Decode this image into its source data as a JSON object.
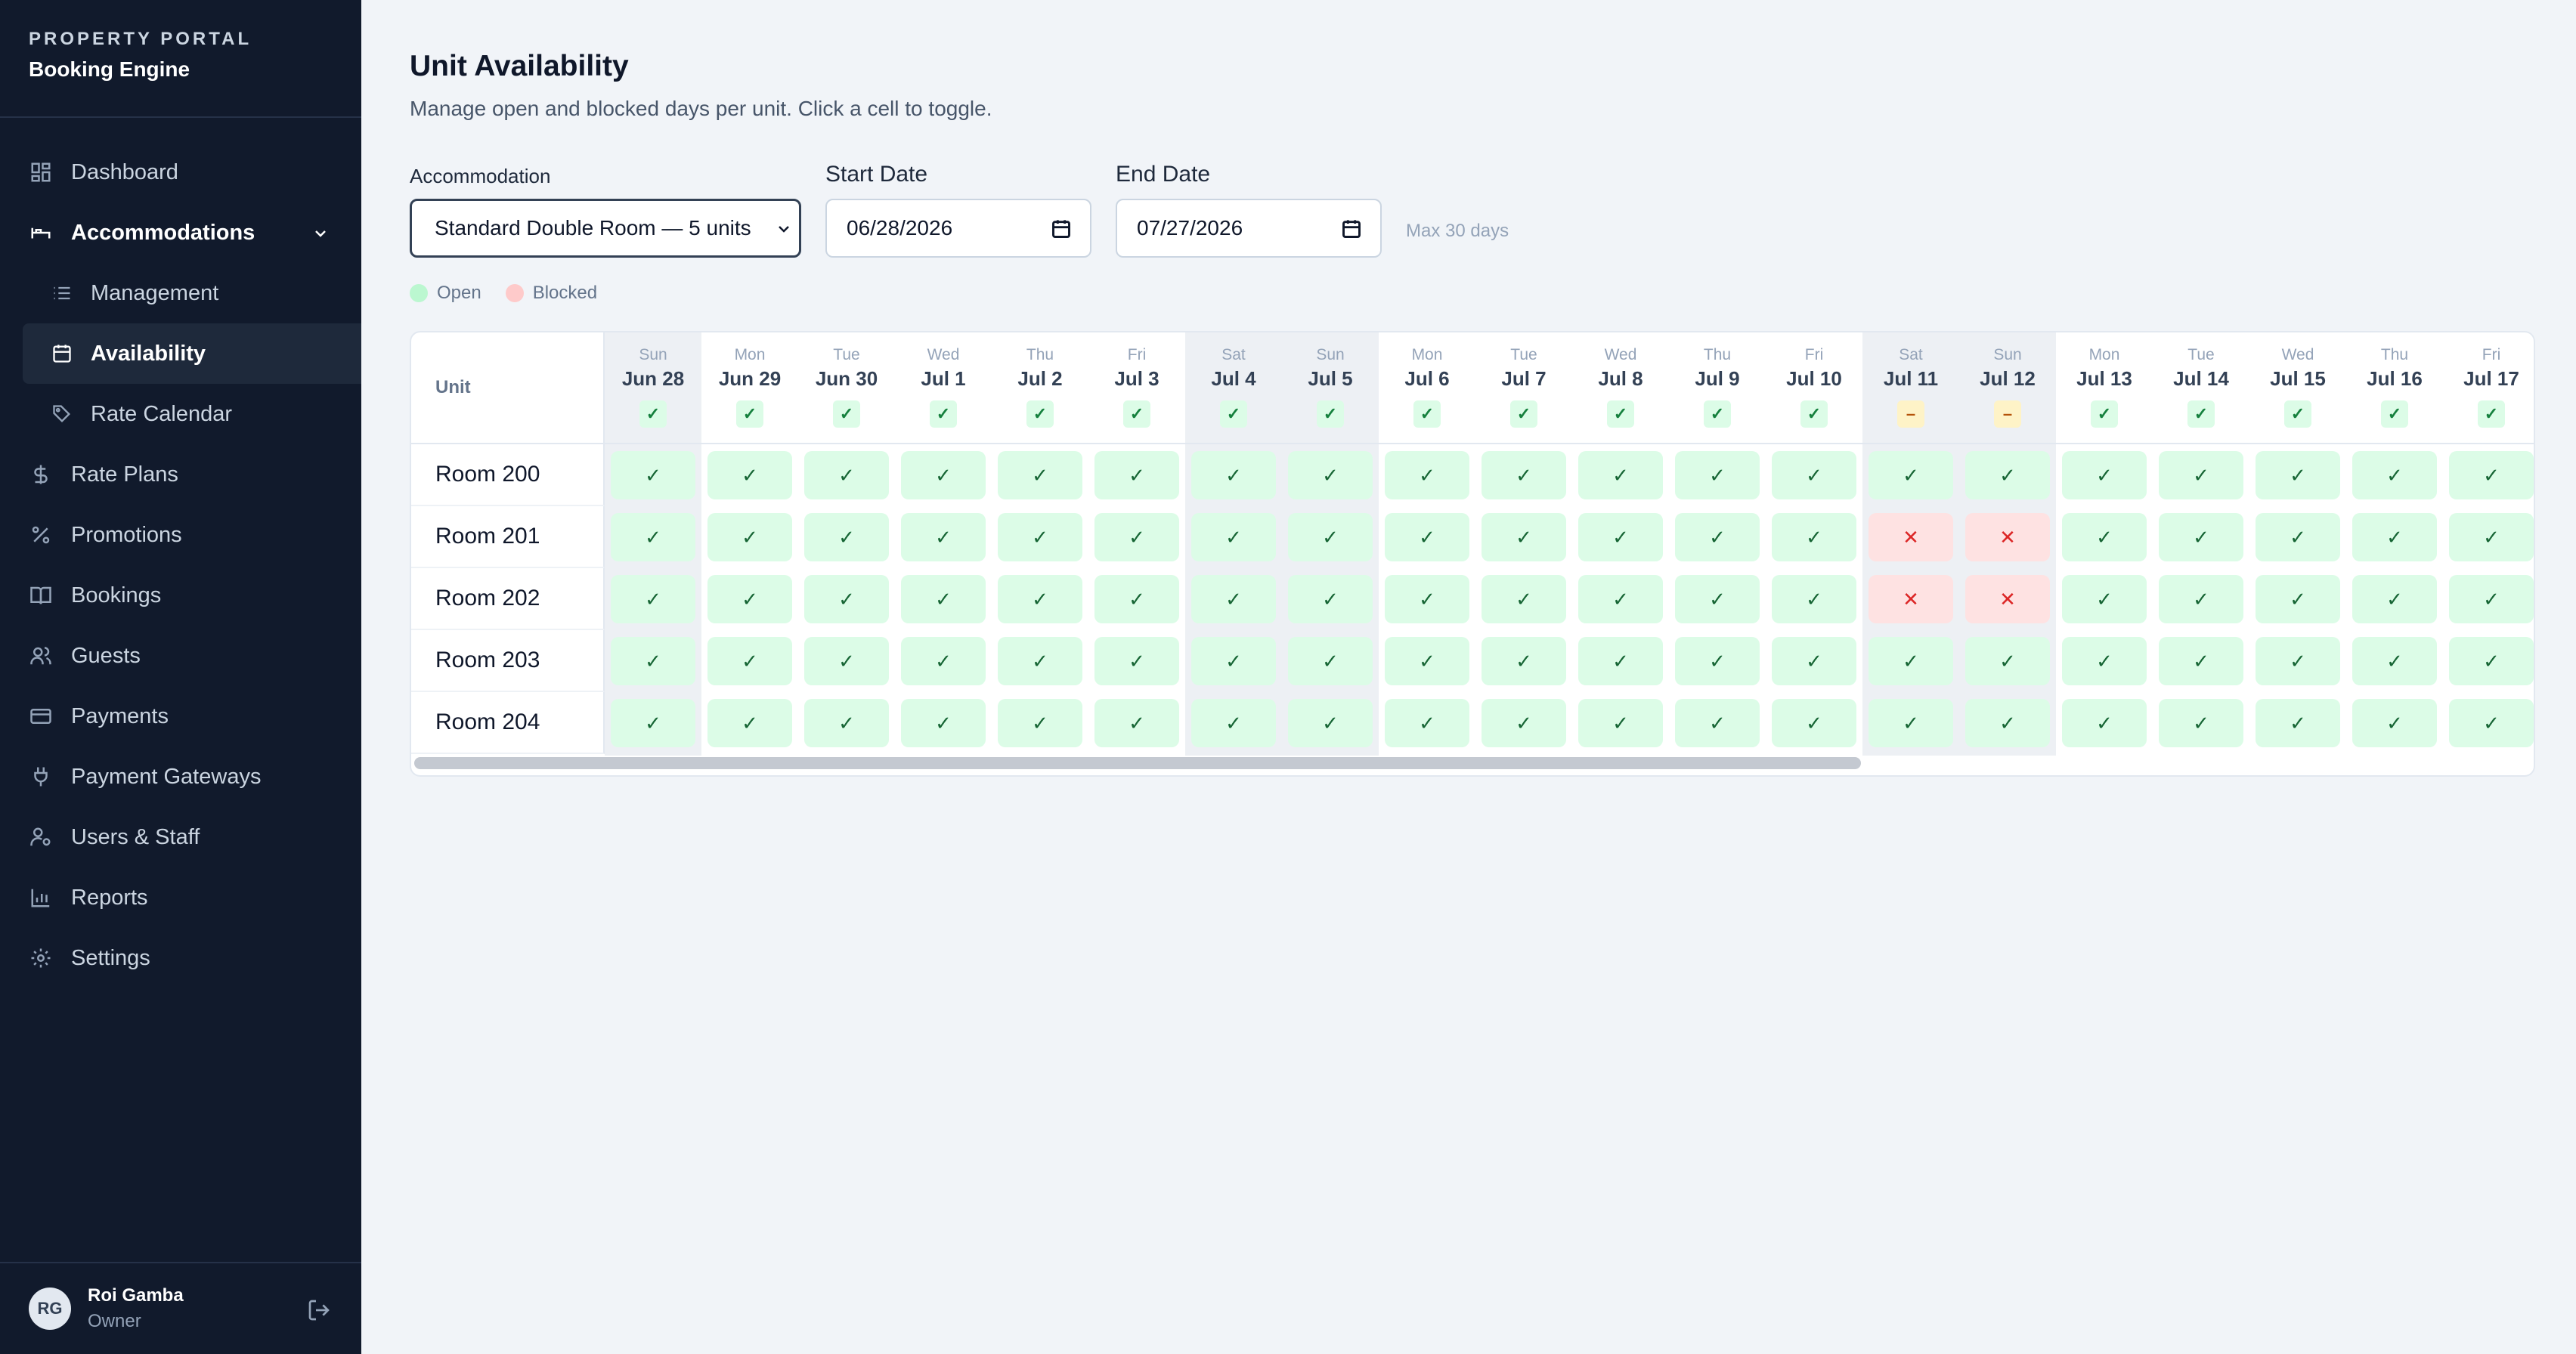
{
  "brand": {
    "kicker": "PROPERTY PORTAL",
    "title": "Booking Engine"
  },
  "nav": {
    "items": [
      {
        "label": "Dashboard",
        "icon": "dashboard-icon"
      },
      {
        "label": "Accommodations",
        "icon": "bed-icon",
        "expanded": true
      },
      {
        "label": "Management",
        "icon": "list-icon",
        "sub": true
      },
      {
        "label": "Availability",
        "icon": "calendar-icon",
        "sub": true,
        "active": true
      },
      {
        "label": "Rate Calendar",
        "icon": "tag-icon",
        "sub": true
      },
      {
        "label": "Rate Plans",
        "icon": "dollar-icon"
      },
      {
        "label": "Promotions",
        "icon": "percent-icon"
      },
      {
        "label": "Bookings",
        "icon": "book-icon"
      },
      {
        "label": "Guests",
        "icon": "users-icon"
      },
      {
        "label": "Payments",
        "icon": "card-icon"
      },
      {
        "label": "Payment Gateways",
        "icon": "plug-icon"
      },
      {
        "label": "Users & Staff",
        "icon": "user-cog-icon"
      },
      {
        "label": "Reports",
        "icon": "bar-chart-icon"
      },
      {
        "label": "Settings",
        "icon": "gear-icon"
      }
    ]
  },
  "user": {
    "initials": "RG",
    "name": "Roi Gamba",
    "role": "Owner"
  },
  "page": {
    "title": "Unit Availability",
    "subtitle": "Manage open and blocked days per unit. Click a cell to toggle."
  },
  "filters": {
    "accommodation_label": "Accommodation",
    "accommodation_value": "Standard Double Room — 5 units",
    "start_label": "Start Date",
    "start_value": "06/28/2026",
    "end_label": "End Date",
    "end_value": "07/27/2026",
    "max_hint": "Max 30 days"
  },
  "legend": {
    "open": "Open",
    "blocked": "Blocked"
  },
  "colors": {
    "open": "#dcfce7",
    "blocked": "#fee2e2",
    "mixed": "#fef3c7",
    "sidebar": "#111a2c"
  },
  "grid": {
    "unit_header": "Unit",
    "days": [
      {
        "dow": "Sun",
        "date": "Jun 28",
        "weekend": true,
        "status": "open"
      },
      {
        "dow": "Mon",
        "date": "Jun 29",
        "weekend": false,
        "status": "open"
      },
      {
        "dow": "Tue",
        "date": "Jun 30",
        "weekend": false,
        "status": "open"
      },
      {
        "dow": "Wed",
        "date": "Jul 1",
        "weekend": false,
        "status": "open"
      },
      {
        "dow": "Thu",
        "date": "Jul 2",
        "weekend": false,
        "status": "open"
      },
      {
        "dow": "Fri",
        "date": "Jul 3",
        "weekend": false,
        "status": "open"
      },
      {
        "dow": "Sat",
        "date": "Jul 4",
        "weekend": true,
        "status": "open"
      },
      {
        "dow": "Sun",
        "date": "Jul 5",
        "weekend": true,
        "status": "open"
      },
      {
        "dow": "Mon",
        "date": "Jul 6",
        "weekend": false,
        "status": "open"
      },
      {
        "dow": "Tue",
        "date": "Jul 7",
        "weekend": false,
        "status": "open"
      },
      {
        "dow": "Wed",
        "date": "Jul 8",
        "weekend": false,
        "status": "open"
      },
      {
        "dow": "Thu",
        "date": "Jul 9",
        "weekend": false,
        "status": "open"
      },
      {
        "dow": "Fri",
        "date": "Jul 10",
        "weekend": false,
        "status": "open"
      },
      {
        "dow": "Sat",
        "date": "Jul 11",
        "weekend": true,
        "status": "mixed"
      },
      {
        "dow": "Sun",
        "date": "Jul 12",
        "weekend": true,
        "status": "mixed"
      },
      {
        "dow": "Mon",
        "date": "Jul 13",
        "weekend": false,
        "status": "open"
      },
      {
        "dow": "Tue",
        "date": "Jul 14",
        "weekend": false,
        "status": "open"
      },
      {
        "dow": "Wed",
        "date": "Jul 15",
        "weekend": false,
        "status": "open"
      },
      {
        "dow": "Thu",
        "date": "Jul 16",
        "weekend": false,
        "status": "open"
      },
      {
        "dow": "Fri",
        "date": "Jul 17",
        "weekend": false,
        "status": "open"
      }
    ],
    "units": [
      {
        "name": "Room 200",
        "blocked_days": []
      },
      {
        "name": "Room 201",
        "blocked_days": [
          "Jul 11",
          "Jul 12"
        ]
      },
      {
        "name": "Room 202",
        "blocked_days": [
          "Jul 11",
          "Jul 12"
        ]
      },
      {
        "name": "Room 203",
        "blocked_days": []
      },
      {
        "name": "Room 204",
        "blocked_days": []
      }
    ]
  }
}
